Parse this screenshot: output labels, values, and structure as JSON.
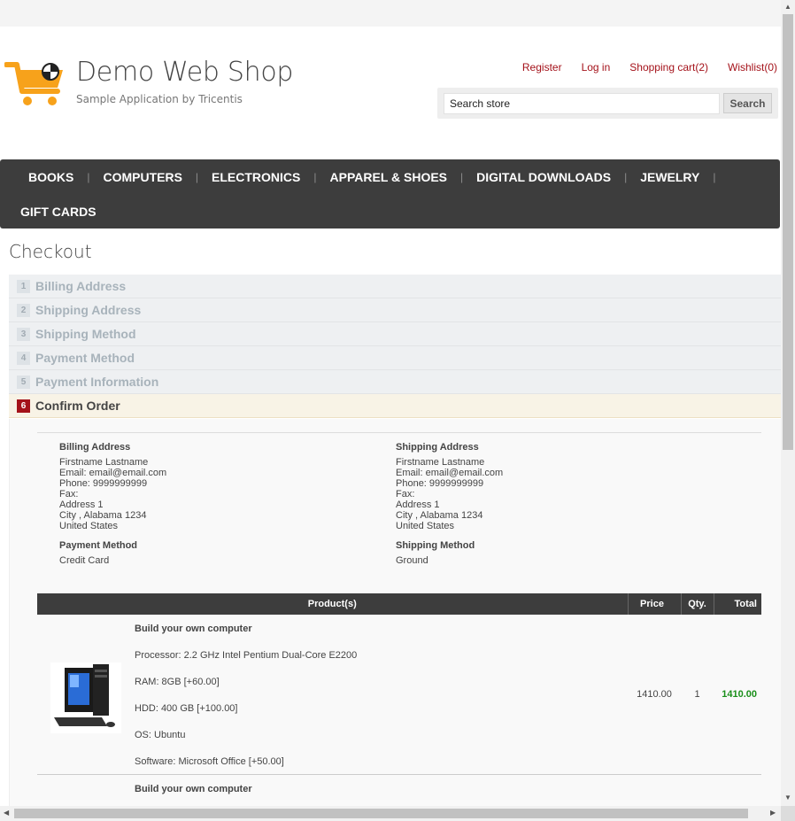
{
  "header": {
    "title": "Demo Web Shop",
    "subtitle": "Sample Application by Tricentis",
    "links": {
      "register": "Register",
      "login": "Log in",
      "cart": "Shopping cart(2)",
      "wishlist": "Wishlist(0)"
    },
    "search": {
      "value": "Search store",
      "button": "Search"
    }
  },
  "menu": {
    "books": "BOOKS",
    "computers": "COMPUTERS",
    "electronics": "ELECTRONICS",
    "apparel": "APPAREL & SHOES",
    "digital": "DIGITAL DOWNLOADS",
    "jewelry": "JEWELRY",
    "gift": "GIFT CARDS",
    "separator": "|"
  },
  "checkout": {
    "title": "Checkout",
    "steps": [
      {
        "num": "1",
        "title": "Billing Address"
      },
      {
        "num": "2",
        "title": "Shipping Address"
      },
      {
        "num": "3",
        "title": "Shipping Method"
      },
      {
        "num": "4",
        "title": "Payment Method"
      },
      {
        "num": "5",
        "title": "Payment Information"
      },
      {
        "num": "6",
        "title": "Confirm Order"
      }
    ]
  },
  "billing": {
    "title": "Billing Address",
    "name": "Firstname Lastname",
    "email": "Email: email@email.com",
    "phone": "Phone: 9999999999",
    "fax": "Fax:",
    "address": "Address 1",
    "city": "City , Alabama 1234",
    "country": "United States"
  },
  "shipping": {
    "title": "Shipping Address",
    "name": "Firstname Lastname",
    "email": "Email: email@email.com",
    "phone": "Phone: 9999999999",
    "fax": "Fax:",
    "address": "Address 1",
    "city": "City , Alabama 1234",
    "country": "United States"
  },
  "payment_method": {
    "title": "Payment Method",
    "value": "Credit Card"
  },
  "shipping_method": {
    "title": "Shipping Method",
    "value": "Ground"
  },
  "cart": {
    "headers": {
      "products": "Product(s)",
      "price": "Price",
      "qty": "Qty.",
      "total": "Total"
    },
    "items": [
      {
        "name": "Build your own computer",
        "processor": "Processor: 2.2 GHz Intel Pentium Dual-Core E2200",
        "ram": "RAM: 8GB [+60.00]",
        "hdd": "HDD: 400 GB [+100.00]",
        "os": "OS: Ubuntu",
        "software": "Software: Microsoft Office [+50.00]",
        "price": "1410.00",
        "qty": "1",
        "total": "1410.00"
      },
      {
        "name": "Build your own computer"
      }
    ]
  },
  "colors": {
    "accent": "#a4121a",
    "menu_bg": "#3d3d3d",
    "total_green": "#1a8f1a",
    "logo_orange": "#f7a21b"
  },
  "icons": {
    "logo": "shopping-cart-icon",
    "product": "desktop-computer-image"
  }
}
